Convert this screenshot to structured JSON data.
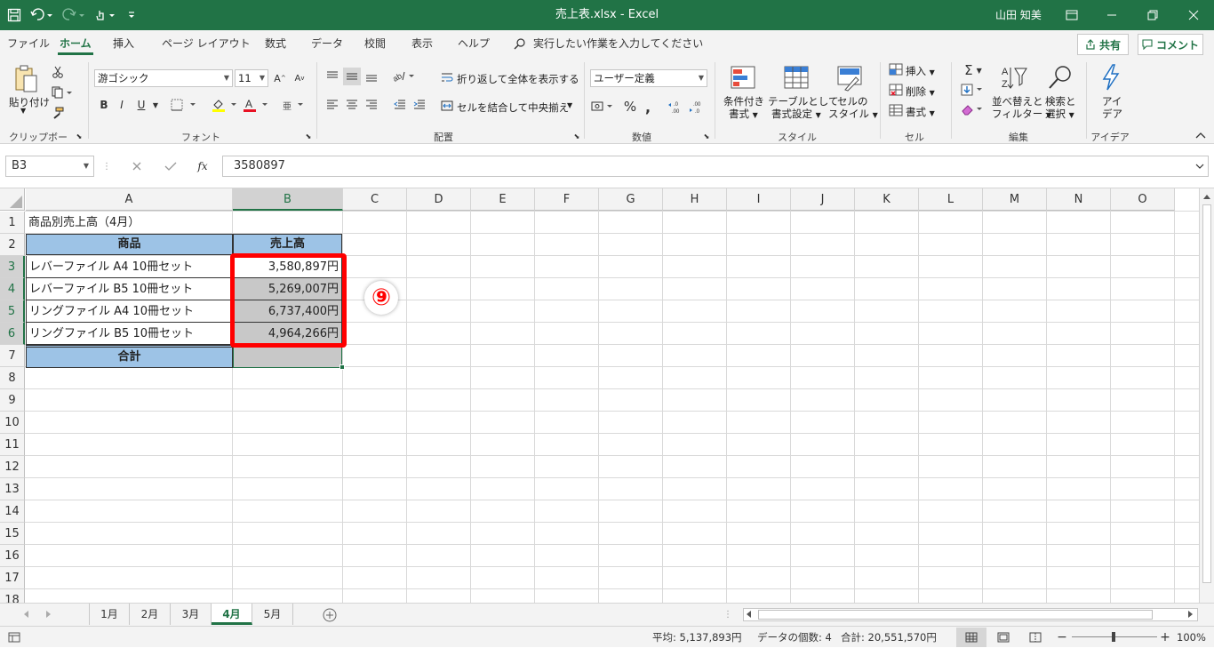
{
  "window": {
    "title": "売上表.xlsx  -  Excel",
    "user": "山田 知美"
  },
  "menu": {
    "tabs": [
      "ファイル",
      "ホーム",
      "挿入",
      "ページ レイアウト",
      "数式",
      "データ",
      "校閲",
      "表示",
      "ヘルプ"
    ],
    "tell_me": "実行したい作業を入力してください",
    "share": "共有",
    "comment": "コメント"
  },
  "ribbon": {
    "clipboard": {
      "paste": "貼り付け",
      "label": "クリップボード"
    },
    "font": {
      "name": "游ゴシック",
      "size": "11",
      "bold": "B",
      "italic": "I",
      "underline": "U",
      "label": "フォント"
    },
    "alignment": {
      "wrap": "折り返して全体を表示する",
      "merge": "セルを結合して中央揃え",
      "label": "配置"
    },
    "number": {
      "format": "ユーザー定義",
      "label": "数値"
    },
    "styles": {
      "conditional": [
        "条件付き",
        "書式"
      ],
      "table": [
        "テーブルとして",
        "書式設定"
      ],
      "cell": [
        "セルの",
        "スタイル"
      ],
      "label": "スタイル"
    },
    "cells": {
      "insert": "挿入",
      "delete": "削除",
      "format": "書式",
      "label": "セル"
    },
    "editing": {
      "sort": [
        "並べ替えと",
        "フィルター"
      ],
      "find": [
        "検索と",
        "選択"
      ],
      "label": "編集"
    },
    "ideas": {
      "btn": [
        "アイ",
        "デア"
      ],
      "label": "アイデア"
    }
  },
  "formula_bar": {
    "name_box": "B3",
    "fx": "fx",
    "content": "3580897"
  },
  "columns": [
    "A",
    "B",
    "C",
    "D",
    "E",
    "F",
    "G",
    "H",
    "I",
    "J",
    "K",
    "L",
    "M",
    "N",
    "O"
  ],
  "rows": [
    "1",
    "2",
    "3",
    "4",
    "5",
    "6",
    "7",
    "8",
    "9",
    "10",
    "11",
    "12",
    "13",
    "14",
    "15",
    "16",
    "17",
    "18"
  ],
  "cells": {
    "a1": "商品別売上高（4月）",
    "header_product": "商品",
    "header_sales": "売上高",
    "items": [
      {
        "name": "レバーファイル A4 10冊セット",
        "value": "3,580,897円"
      },
      {
        "name": "レバーファイル B5 10冊セット",
        "value": "5,269,007円"
      },
      {
        "name": "リングファイル A4 10冊セット",
        "value": "6,737,400円"
      },
      {
        "name": "リングファイル B5 10冊セット",
        "value": "4,964,266円"
      }
    ],
    "total_label": "合計"
  },
  "annotation": "⑨",
  "sheets": [
    "1月",
    "2月",
    "3月",
    "4月",
    "5月"
  ],
  "active_sheet": "4月",
  "status": {
    "average": "平均: 5,137,893円",
    "count": "データの個数: 4",
    "sum": "合計: 20,551,570円",
    "zoom": "100%"
  },
  "colors": {
    "accent": "#217346",
    "header_fill": "#9dc3e6",
    "selection_gray": "#c8c8c8",
    "highlight_red": "#ff0000"
  }
}
